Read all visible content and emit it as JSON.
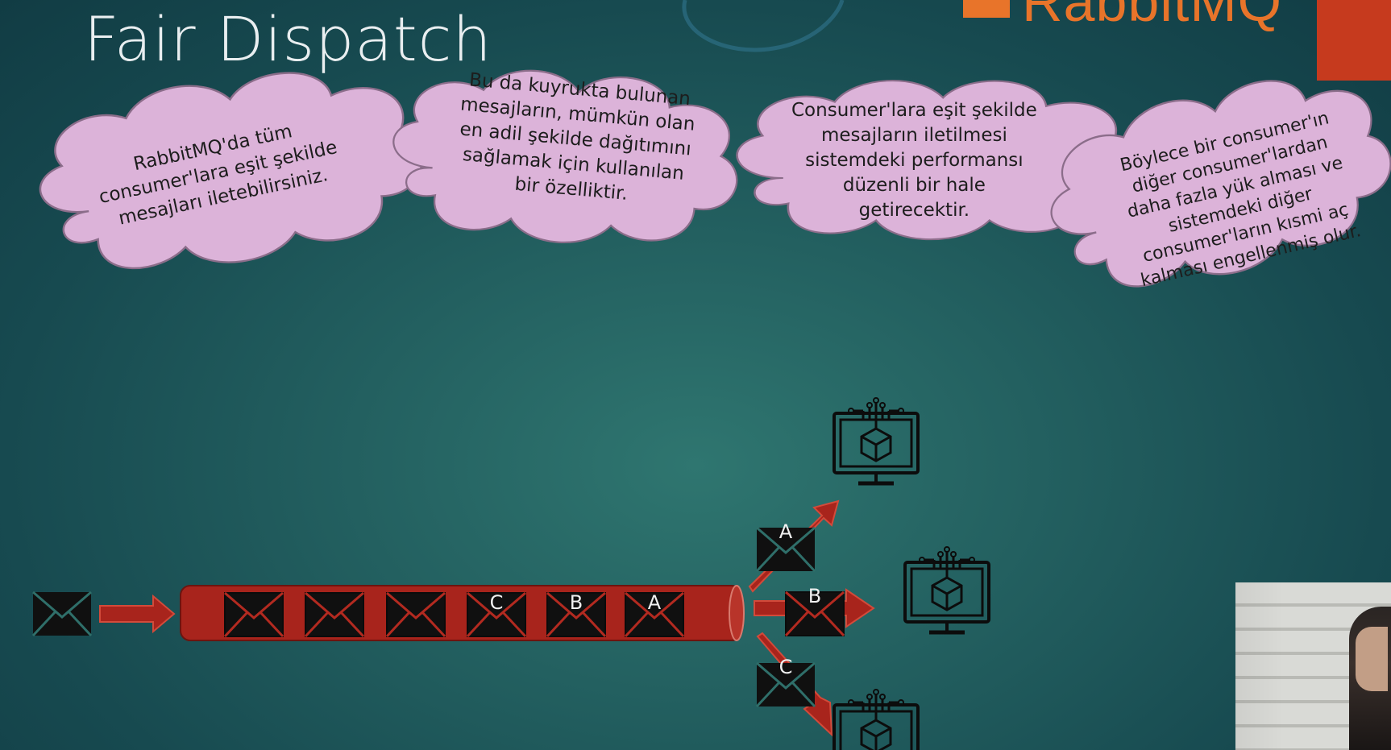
{
  "slide": {
    "title": "Fair Dispatch",
    "logo_text": "RabbitMQ"
  },
  "clouds": [
    {
      "lines": [
        "RabbitMQ'da tüm",
        "consumer'lara eşit şekilde",
        "mesajları iletebilirsiniz."
      ]
    },
    {
      "lines": [
        "Bu da kuyrukta bulunan",
        "mesajların, mümkün olan",
        "en adil şekilde dağıtımını",
        "sağlamak için kullanılan",
        "bir özelliktir."
      ]
    },
    {
      "lines": [
        "Consumer'lara eşit şekilde",
        "mesajların iletilmesi",
        "sistemdeki performansı",
        "düzenli bir hale",
        "getirecektir."
      ]
    },
    {
      "lines": [
        "Böylece bir consumer'ın",
        "diğer consumer'lardan",
        "daha fazla yük alması ve",
        "sistemdeki diğer",
        "consumer'ların kısmi aç",
        "kalması engellenmiş olur."
      ]
    }
  ],
  "queue": {
    "messages": [
      "",
      "",
      "",
      "C",
      "B",
      "A"
    ]
  },
  "dispatch": [
    {
      "label": "A",
      "target": "consumer-top"
    },
    {
      "label": "B",
      "target": "consumer-middle"
    },
    {
      "label": "C",
      "target": "consumer-bottom"
    }
  ],
  "colors": {
    "accent_red": "#a8241c",
    "logo_orange": "#e8742a",
    "cloud_fill": "#dcb3d9",
    "cloud_stroke": "#8b6d8a"
  },
  "icons": {
    "producer": "envelope-icon",
    "consumer": "monitor-cube-icon"
  }
}
